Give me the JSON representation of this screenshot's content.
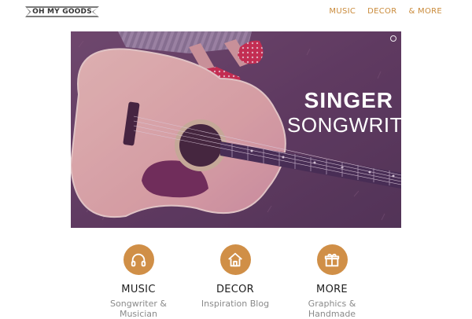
{
  "header": {
    "logo_text": "OH MY GOODS",
    "nav": [
      {
        "label": "MUSIC"
      },
      {
        "label": "DECOR"
      },
      {
        "label": "& MORE"
      }
    ]
  },
  "hero": {
    "line1": "SINGER",
    "line2": "SONGWRITER"
  },
  "features": [
    {
      "icon": "headphones-icon",
      "title": "MUSIC",
      "subtitle": "Songwriter & Musician"
    },
    {
      "icon": "home-icon",
      "title": "DECOR",
      "subtitle": "Inspiration Blog"
    },
    {
      "icon": "gift-icon",
      "title": "MORE",
      "subtitle": "Graphics & Handmade"
    }
  ],
  "colors": {
    "accent": "#d08f47",
    "nav_text": "#c98a3a"
  }
}
